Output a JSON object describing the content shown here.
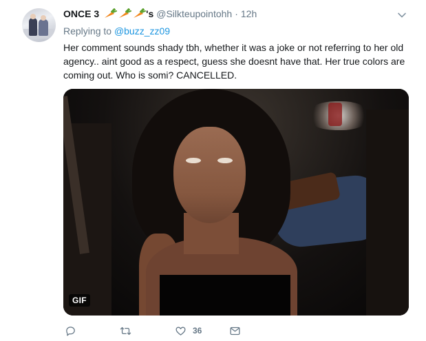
{
  "tweet": {
    "author_name": "ONCE 3",
    "author_name_suffix": "'s",
    "author_emoji": [
      "carrot-emoji",
      "carrot-emoji",
      "carrot-emoji"
    ],
    "handle": "@Silkteupointohh",
    "separator": "·",
    "time": "12h",
    "replying_prefix": "Replying to",
    "replying_to": "@buzz_zz09",
    "text": "Her comment sounds shady tbh, whether it was a joke or not referring to her old agency.. aint good as a respect, guess she doesnt have that. Her true colors are coming out. Who is somi? CANCELLED.",
    "media": {
      "badge": "GIF"
    },
    "actions": {
      "reply": {
        "icon": "reply-icon"
      },
      "retweet": {
        "icon": "retweet-icon"
      },
      "like": {
        "icon": "heart-icon",
        "count": "36"
      },
      "dm": {
        "icon": "envelope-icon"
      }
    }
  },
  "colors": {
    "link": "#1b95e0",
    "secondary_text": "#657786",
    "primary_text": "#14171a"
  }
}
